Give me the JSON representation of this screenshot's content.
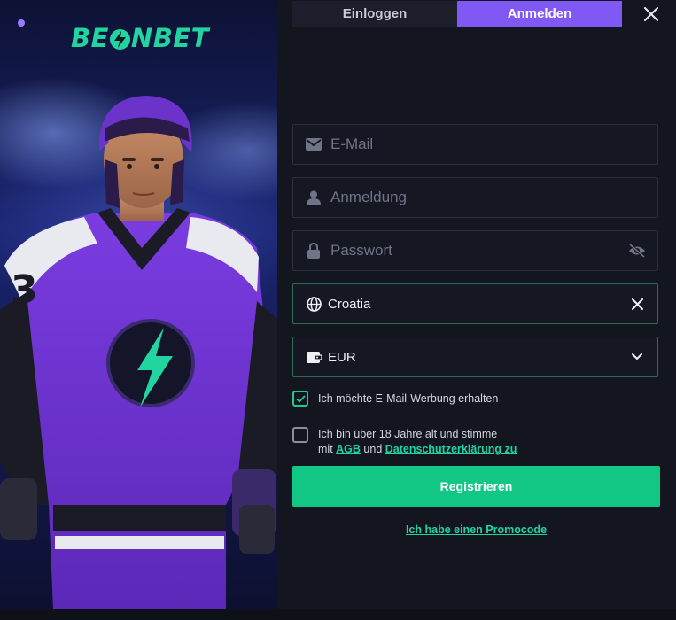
{
  "brand": {
    "logo_left": "BE",
    "logo_right": "NBET",
    "logo_color": "#21d4a0"
  },
  "tabs": [
    {
      "label": "Einloggen",
      "active": false
    },
    {
      "label": "Anmelden",
      "active": true
    }
  ],
  "form": {
    "email": {
      "placeholder": "E-Mail",
      "value": ""
    },
    "username": {
      "placeholder": "Anmeldung",
      "value": ""
    },
    "password": {
      "placeholder": "Passwort",
      "value": ""
    },
    "country": {
      "value": "Croatia"
    },
    "currency": {
      "value": "EUR"
    }
  },
  "checkboxes": {
    "email_ads": {
      "label": "Ich möchte E-Mail-Werbung erhalten",
      "checked": true
    },
    "terms": {
      "line1": "Ich bin über 18 Jahre alt und stimme",
      "prefix": "mit",
      "agb": "AGB",
      "and": "und",
      "privacy": "Datenschutzerklärung zu",
      "checked": false
    }
  },
  "register_label": "Registrieren",
  "promocode_label": "Ich habe einen Promocode",
  "colors": {
    "accent": "#12c683",
    "tab_active": "#8059f5",
    "background": "#14161f"
  },
  "icons": {
    "close": "close-icon",
    "email": "envelope-icon",
    "user": "user-icon",
    "lock": "lock-icon",
    "eye": "eye-off-icon",
    "globe": "globe-icon",
    "wallet": "wallet-icon",
    "chevron": "chevron-down-icon",
    "check": "check-icon"
  }
}
